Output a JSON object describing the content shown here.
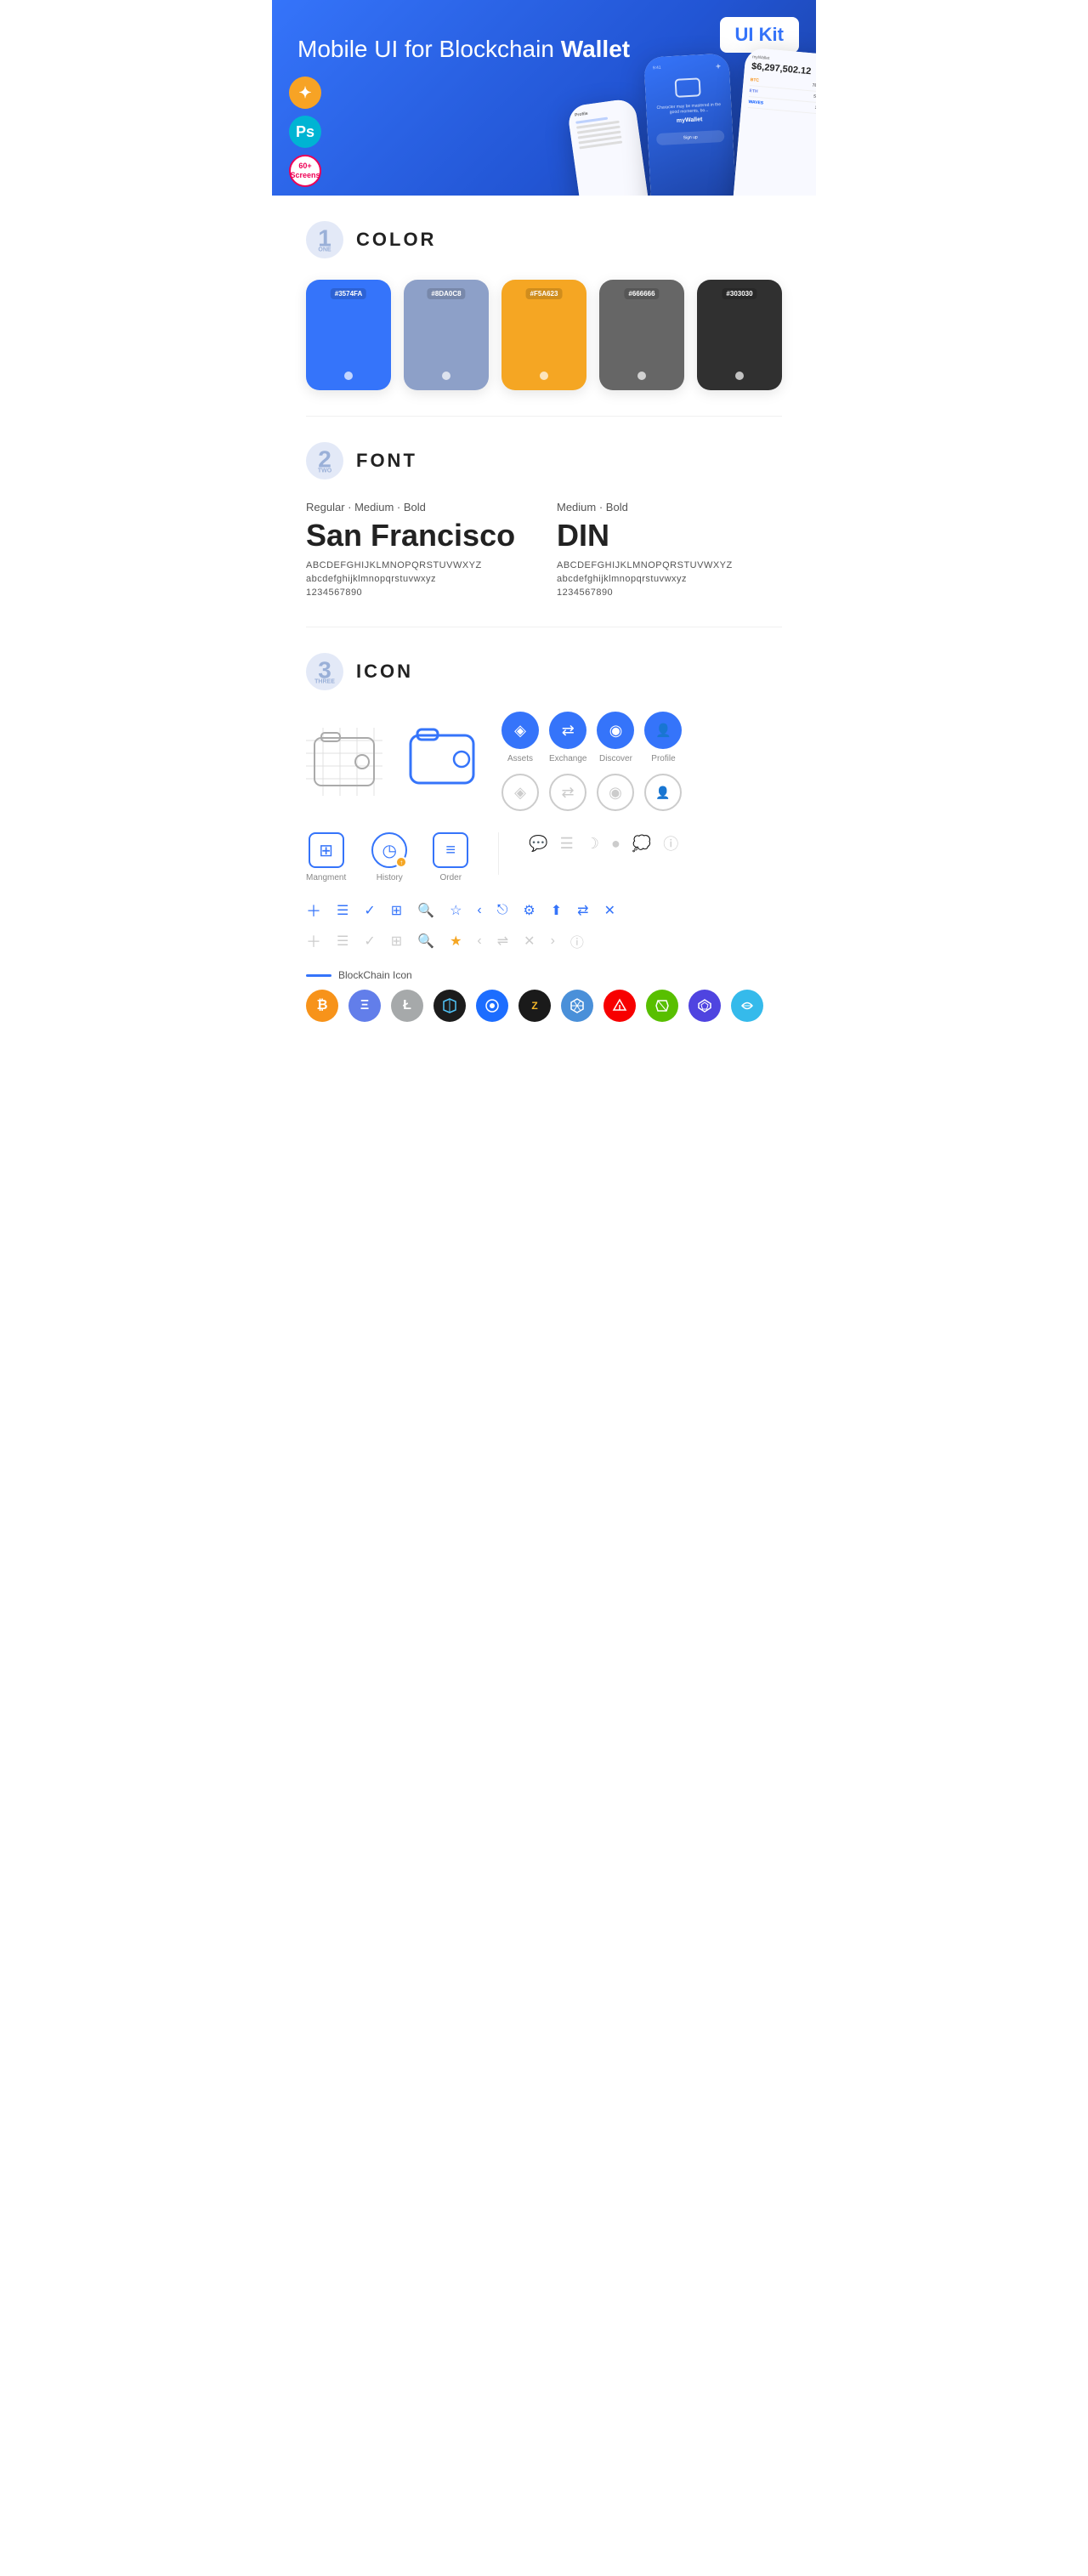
{
  "hero": {
    "title": "Mobile UI for Blockchain ",
    "title_bold": "Wallet",
    "badge": "UI Kit",
    "sketch_icon": "◈",
    "ps_icon": "Ps",
    "screens_label": "60+\nScreens"
  },
  "sections": {
    "color": {
      "num": "1",
      "sub": "ONE",
      "title": "COLOR",
      "swatches": [
        {
          "hex": "#3574FA",
          "code": "#3574FA"
        },
        {
          "hex": "#8DA0C8",
          "code": "#8DA0C8"
        },
        {
          "hex": "#F5A623",
          "code": "#F5A623"
        },
        {
          "hex": "#666666",
          "code": "#666666"
        },
        {
          "hex": "#303030",
          "code": "#303030"
        }
      ]
    },
    "font": {
      "num": "2",
      "sub": "TWO",
      "title": "FONT",
      "fonts": [
        {
          "style": "Regular · Medium · Bold",
          "name": "San Francisco",
          "uppercase": "ABCDEFGHIJKLMNOPQRSTUVWXYZ",
          "lowercase": "abcdefghijklmnopqrstuvwxyz",
          "numbers": "1234567890"
        },
        {
          "style": "Medium · Bold",
          "name": "DIN",
          "uppercase": "ABCDEFGHIJKLMNOPQRSTUVWXYZ",
          "lowercase": "abcdefghijklmnopqrstuvwxyz",
          "numbers": "1234567890"
        }
      ]
    },
    "icon": {
      "num": "3",
      "sub": "THREE",
      "title": "ICON",
      "nav_icons": [
        {
          "label": "Assets",
          "glyph": "◈"
        },
        {
          "label": "Exchange",
          "glyph": "⇄"
        },
        {
          "label": "Discover",
          "glyph": "●"
        },
        {
          "label": "Profile",
          "glyph": "👤"
        }
      ],
      "action_icons": [
        {
          "label": "Mangment",
          "type": "mgmt"
        },
        {
          "label": "History",
          "type": "history"
        },
        {
          "label": "Order",
          "type": "order"
        }
      ],
      "misc_icons": [
        "＋",
        "☰",
        "✓",
        "⊞",
        "🔍",
        "☆",
        "‹",
        "‹‹",
        "⚙",
        "⬆",
        "⇄",
        "✕"
      ],
      "blockchain_label": "BlockChain Icon",
      "coins": [
        {
          "label": "BTC",
          "class": "coin-btc",
          "glyph": "₿"
        },
        {
          "label": "ETH",
          "class": "coin-eth",
          "glyph": "Ξ"
        },
        {
          "label": "LTC",
          "class": "coin-ltc",
          "glyph": "Ł"
        },
        {
          "label": "DASH",
          "class": "coin-dash",
          "glyph": "D"
        },
        {
          "label": "DASH2",
          "class": "coin-dash",
          "glyph": "◎"
        },
        {
          "label": "ZCASH",
          "class": "coin-z",
          "glyph": "Z"
        },
        {
          "label": "GRID",
          "class": "coin-grid",
          "glyph": "⬡"
        },
        {
          "label": "ARK",
          "class": "coin-ark",
          "glyph": "▲"
        },
        {
          "label": "NEO",
          "class": "coin-neo",
          "glyph": "N"
        },
        {
          "label": "POLY",
          "class": "coin-poly",
          "glyph": "⬡"
        },
        {
          "label": "BITS",
          "class": "coin-bitshares",
          "glyph": "~"
        }
      ]
    }
  }
}
